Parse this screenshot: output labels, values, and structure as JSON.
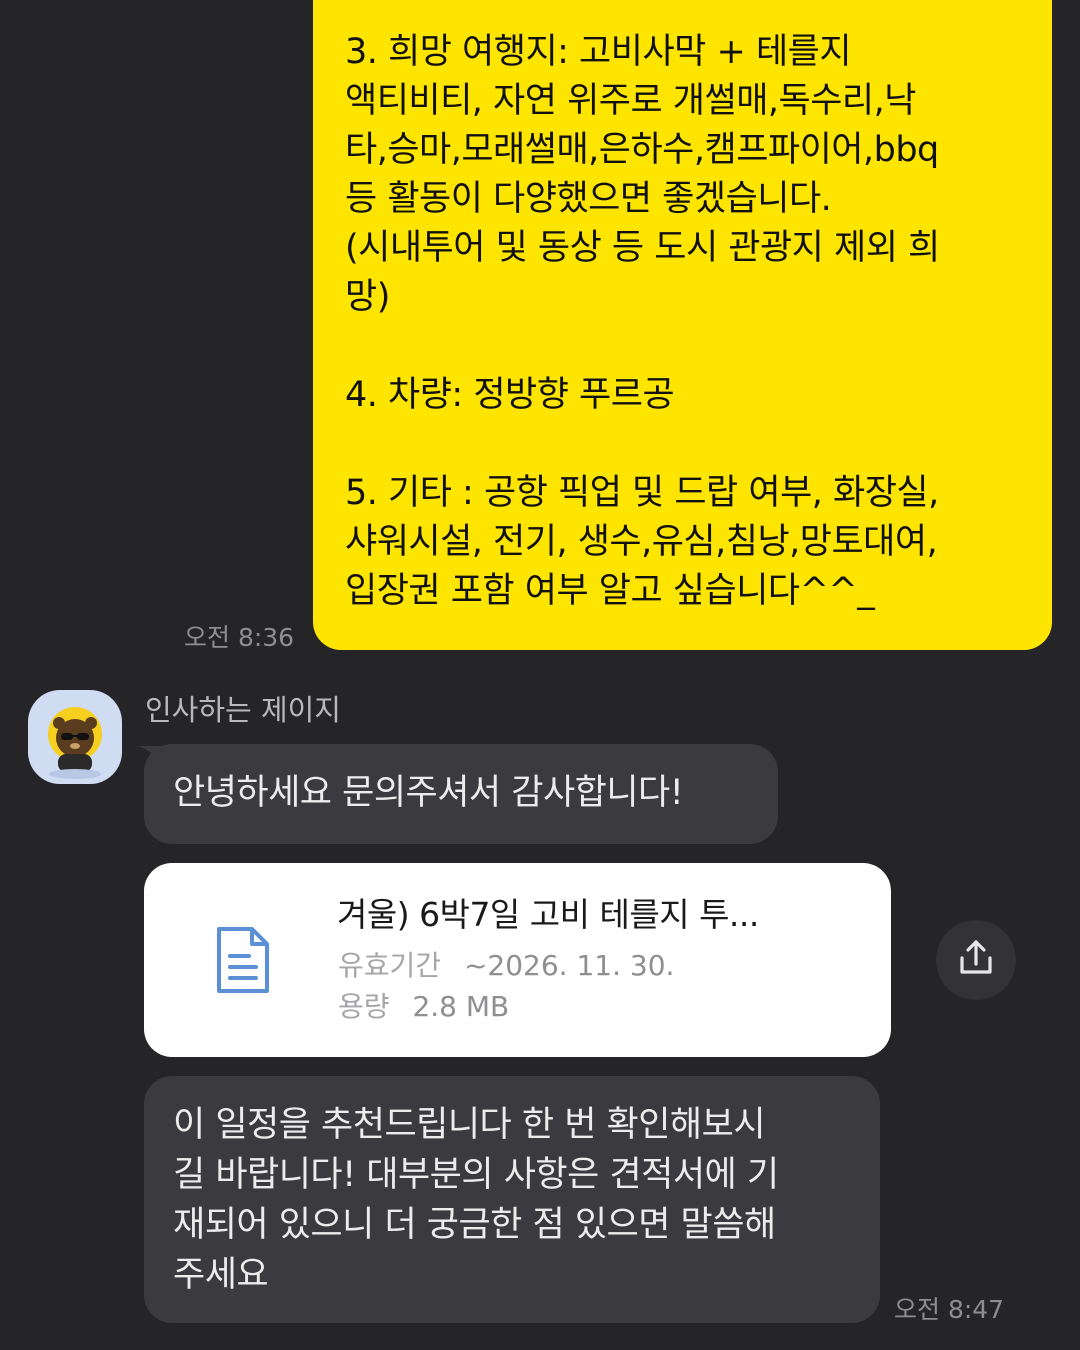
{
  "messages": {
    "outgoing_text": "3. 희망 여행지: 고비사막 + 테를지\n액티비티, 자연 위주로 개썰매,독수리,낙\n타,승마,모래썰매,은하수,캠프파이어,bbq\n등 활동이 다양했으면 좋겠습니다.\n(시내투어 및 동상 등 도시 관광지 제외 희\n망)\n\n4. 차량: 정방향 푸르공\n\n5. 기타 : 공항 픽업 및 드랍 여부, 화장실,\n샤워시설, 전기, 생수,유심,침낭,망토대여,\n입장권 포함 여부 알고 싶습니다^^_",
    "outgoing_time": "오전 8:36",
    "sender_name": "인사하는 제이지",
    "greeting": "안녕하세요 문의주셔서 감사합니다!",
    "file": {
      "title": "겨울) 6박7일 고비 테를지 투...",
      "validity_label": "유효기간",
      "validity_value": "~2026. 11. 30.",
      "size_label": "용량",
      "size_value": "2.8 MB",
      "icon": "document-icon"
    },
    "share_icon": "share-icon",
    "recommend_text": "이 일정을 추천드립니다 한 번 확인해보시\n길 바랍니다! 대부분의 사항은 견적서에 기\n재되어 있으니 더 궁금한 점 있으면 말씀해\n주세요",
    "incoming_time": "오전 8:47"
  },
  "colors": {
    "background": "#252528",
    "outgoing_bubble": "#FEE500",
    "incoming_bubble": "#3b3b3f",
    "file_card": "#ffffff",
    "file_icon": "#5b8fd6"
  }
}
